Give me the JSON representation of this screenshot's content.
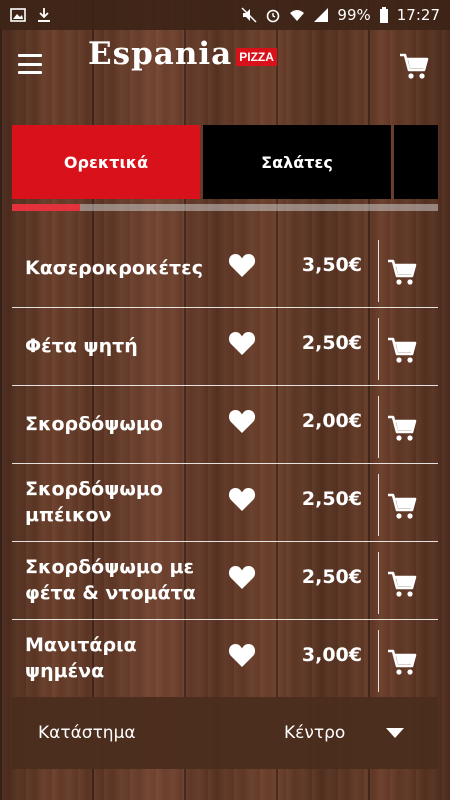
{
  "status_bar": {
    "battery": "99%",
    "time": "17:27"
  },
  "app": {
    "logo_text": "Espania",
    "logo_badge": "PIZZA"
  },
  "tabs": [
    {
      "label": "Ορεκτικά",
      "active": true
    },
    {
      "label": "Σαλάτες",
      "active": false
    },
    {
      "label": "",
      "active": false
    }
  ],
  "tab_progress": 0.16,
  "menu_items": [
    {
      "name": "Κασεροκροκέτες",
      "price": "3,50€"
    },
    {
      "name": "Φέτα ψητή",
      "price": "2,50€"
    },
    {
      "name": "Σκορδόψωμο",
      "price": "2,00€"
    },
    {
      "name": "Σκορδόψωμο μπέικον",
      "price": "2,50€"
    },
    {
      "name": "Σκορδόψωμο με φέτα & ντομάτα",
      "price": "2,50€"
    },
    {
      "name": "Μανιτάρια ψημένα",
      "price": "3,00€"
    }
  ],
  "store": {
    "label": "Κατάστημα",
    "value": "Κέντρο"
  },
  "colors": {
    "accent_red": "#d9111b",
    "tab_black": "#000000",
    "wood_brown": "#5a3424"
  },
  "icons": {
    "menu": "hamburger-icon",
    "cart": "shopping-cart-icon",
    "favorite": "heart-icon",
    "dropdown": "caret-down-icon"
  }
}
